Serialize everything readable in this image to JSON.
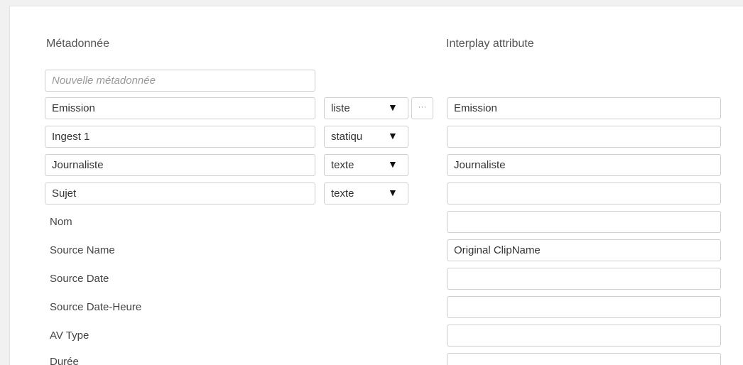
{
  "headers": {
    "left": "Métadonnée",
    "right": "Interplay attribute"
  },
  "new_metadata": {
    "placeholder": "Nouvelle métadonnée",
    "value": ""
  },
  "rows": [
    {
      "name": "Emission",
      "type": "liste",
      "has_dots": true,
      "attribute": "Emission"
    },
    {
      "name": "Ingest 1",
      "type": "statiqu",
      "attribute": ""
    },
    {
      "name": "Journaliste",
      "type": "texte",
      "attribute": "Journaliste"
    },
    {
      "name": "Sujet",
      "type": "texte",
      "attribute": ""
    },
    {
      "label": "Nom",
      "attribute": ""
    },
    {
      "label": "Source Name",
      "attribute": "Original ClipName"
    },
    {
      "label": "Source Date",
      "attribute": ""
    },
    {
      "label": "Source Date-Heure",
      "attribute": ""
    },
    {
      "label": "AV Type",
      "attribute": ""
    },
    {
      "label": "Durée",
      "attribute": ""
    }
  ],
  "dots_glyph": "···",
  "arrow_glyph": "▼"
}
